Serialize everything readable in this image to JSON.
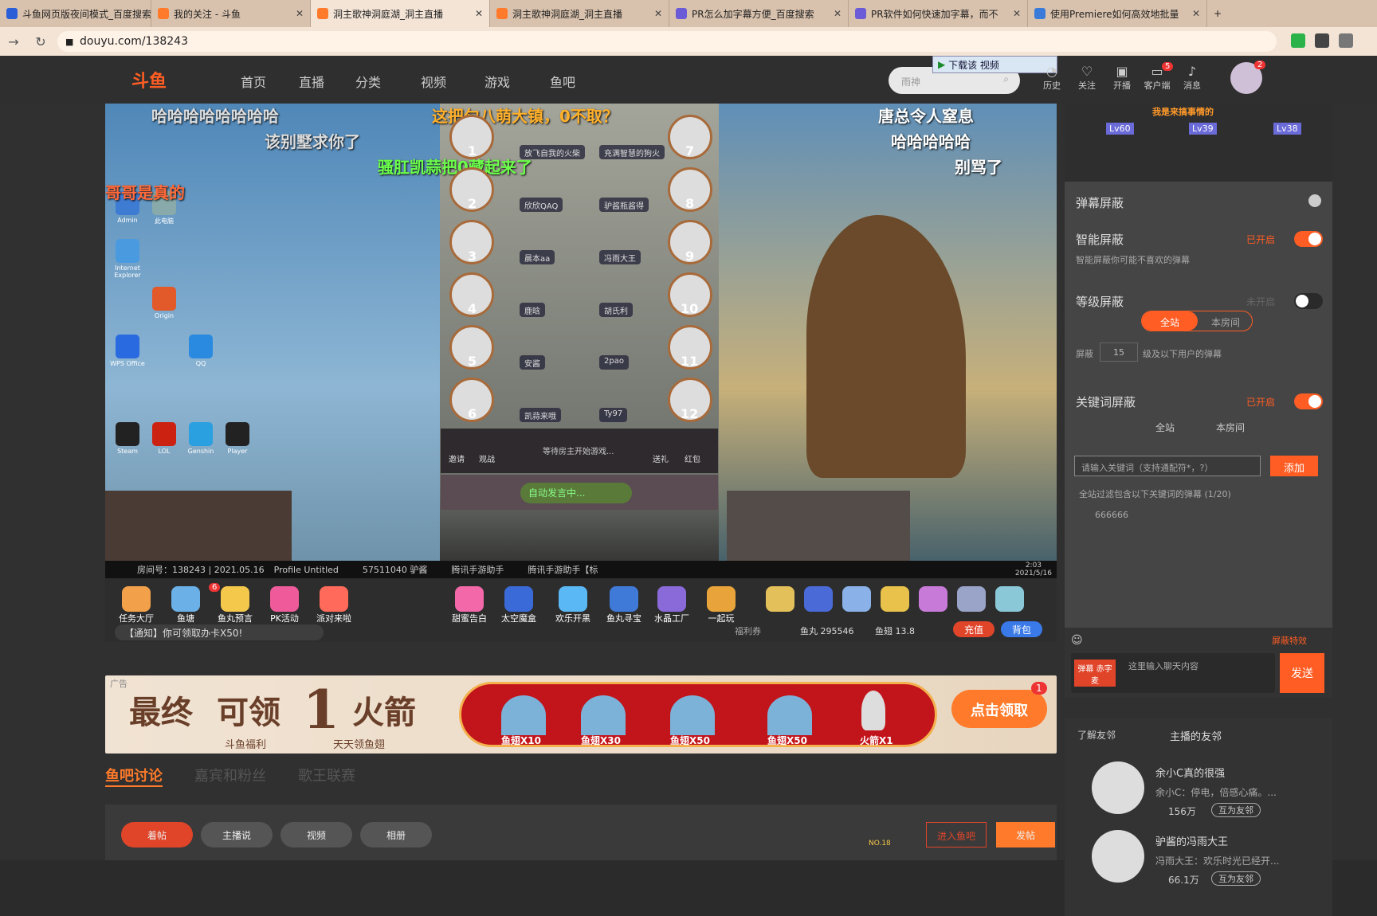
{
  "browser": {
    "tabs": [
      {
        "title": "斗鱼网页版夜间模式_百度搜索"
      },
      {
        "title": "我的关注 - 斗鱼"
      },
      {
        "title": "洞主歌神洞庭湖_洞主直播"
      },
      {
        "title": "洞主歌神洞庭湖_洞主直播"
      },
      {
        "title": "PR怎么加字幕方便_百度搜索"
      },
      {
        "title": "PR软件如何快速加字幕，而不"
      },
      {
        "title": "使用Premiere如何高效地批量"
      }
    ],
    "url": "douyu.com/138243"
  },
  "site": {
    "logo": "斗鱼",
    "nav": [
      "首页",
      "直播",
      "分类",
      "视频",
      "游戏",
      "鱼吧"
    ],
    "search_placeholder": "雨神",
    "download_btn": "下载该 视频",
    "top_icons": [
      "历史",
      "关注",
      "开播",
      "客户端",
      "消息"
    ],
    "avatar_badge": "2",
    "client_badge": "5"
  },
  "player": {
    "overlays": [
      {
        "text": "哈哈哈哈哈哈哈哈",
        "color": "#f4f4c0"
      },
      {
        "text": "该别墅求你了",
        "color": "#f4f4c0"
      },
      {
        "text": "骚肛凯蒜把0藏起来了",
        "color": "#6cff4a"
      },
      {
        "text": "哥哥是真的",
        "color": "#ff6a3a"
      },
      {
        "text": "这把匀八萌大镇，0不取？",
        "color": "#ffb02a"
      },
      {
        "text": "唐总令人窒息",
        "color": "#fff"
      },
      {
        "text": "哈哈哈哈哈",
        "color": "#fff"
      },
      {
        "text": "别骂了",
        "color": "#fff"
      }
    ],
    "seats_left": [
      {
        "num": "1",
        "name": "放飞自我的火柴"
      },
      {
        "num": "2",
        "name": "欣欣QAQ"
      },
      {
        "num": "3",
        "name": "晨本aa"
      },
      {
        "num": "4",
        "name": "鹿晗"
      },
      {
        "num": "5",
        "name": "安酱"
      },
      {
        "num": "6",
        "name": "凯蒜来哦"
      }
    ],
    "seats_right": [
      {
        "num": "7",
        "name": "充满智慧的狗火"
      },
      {
        "num": "8",
        "name": "驴酱瓶酱得"
      },
      {
        "num": "9",
        "name": "冯雨大王"
      },
      {
        "num": "10",
        "name": "胡氏利"
      },
      {
        "num": "11",
        "name": "2pao"
      },
      {
        "num": "12",
        "name": "Ty97"
      }
    ],
    "game_bar": {
      "invite": "邀请",
      "watch": "观战",
      "waiting": "等待房主开始游戏...",
      "gift": "送礼",
      "redpack": "红包",
      "auto": "自动发言中..."
    },
    "desktop_icons": [
      "Admin",
      "Internet Explorer",
      "此电脑",
      "Origin",
      "WPS Office",
      "QQ",
      "Steam",
      "LOL",
      "Genshin",
      "Player"
    ],
    "room_info": "房间号：138243 | 2021.05.16",
    "taskbar_items": [
      "Profile Untitled",
      "57511040 驴酱",
      "腾讯手游助手",
      "腾讯手游助手【标"
    ],
    "tray_time": "2:03",
    "tray_date": "2021/5/16"
  },
  "giftbar": {
    "left": [
      {
        "label": "任务大厅",
        "color": "#f2a14a"
      },
      {
        "label": "鱼塘",
        "color": "#6bb1e8",
        "badge": "6"
      },
      {
        "label": "鱼丸预言",
        "color": "#f4c84a"
      },
      {
        "label": "PK活动",
        "color": "#ef5b9a"
      },
      {
        "label": "派对来啦",
        "color": "#ff6a5a"
      }
    ],
    "mid": [
      {
        "label": "甜蜜告白",
        "color": "#f268a8"
      },
      {
        "label": "太空魔盒",
        "color": "#3a6ad8"
      },
      {
        "label": "欢乐开黑",
        "color": "#5ab8f4"
      },
      {
        "label": "鱼丸寻宝",
        "color": "#3f7ad8"
      },
      {
        "label": "水晶工厂",
        "color": "#8a6ad8"
      },
      {
        "label": "一起玩",
        "color": "#e8a43a"
      }
    ],
    "notice": "【通知】你可领取办卡X50!",
    "welfare": "福利券",
    "fishball": "鱼丸 295546",
    "fishfin": "鱼翅 13.8",
    "recharge": "充值",
    "bag": "背包"
  },
  "banner": {
    "ad": "广告",
    "t1": "最终",
    "t2": "可领",
    "t3": "1",
    "t4": "火箭",
    "sub1": "斗鱼福利",
    "sub2": "天天领鱼翅",
    "items": [
      "鱼翅X10",
      "鱼翅X30",
      "鱼翅X50",
      "鱼翅X50",
      "火箭X1"
    ],
    "claim": "点击领取",
    "claim_badge": "1"
  },
  "tabs": [
    "鱼吧讨论",
    "嘉宾和粉丝",
    "歌王联赛"
  ],
  "post_buttons": [
    "着帖",
    "主播说",
    "视频",
    "相册"
  ],
  "post_right": {
    "enter": "进入鱼吧",
    "post": "发帖",
    "rank": "NO.18"
  },
  "side": {
    "title": "弹幕屏蔽",
    "smart": {
      "label": "智能屏蔽",
      "state": "已开启",
      "desc": "智能屏蔽你可能不喜欢的弹幕"
    },
    "level": {
      "label": "等级屏蔽",
      "state": "未开启",
      "all": "全站",
      "room": "本房间",
      "prefix": "屏蔽",
      "value": "15",
      "suffix": "级及以下用户的弹幕"
    },
    "keyword": {
      "label": "关键词屏蔽",
      "state": "已开启",
      "all": "全站",
      "room": "本房间",
      "placeholder": "请输入关键词（支持通配符*，?）",
      "add": "添加",
      "summary": "全站过滤包含以下关键词的弹幕 (1/20)",
      "item": "666666"
    },
    "chat_placeholder": "这里输入聊天内容",
    "send": "发送",
    "effect": "屏蔽特效",
    "fan_btn": "弹幕 赤字麦",
    "ranks": [
      "Lv60",
      "Lv39",
      "Lv38"
    ],
    "ranker_text": "我是来搞事情的"
  },
  "friends": {
    "header1": "了解友邻",
    "header2": "主播的友邻",
    "list": [
      {
        "name": "余小C真的很强",
        "desc": "余小C：停电，倍感心痛。...",
        "count": "156万",
        "tag": "互为友邻"
      },
      {
        "name": "驴酱的冯雨大王",
        "desc": "冯雨大王：欢乐时光已经开...",
        "count": "66.1万",
        "tag": "互为友邻"
      }
    ]
  }
}
